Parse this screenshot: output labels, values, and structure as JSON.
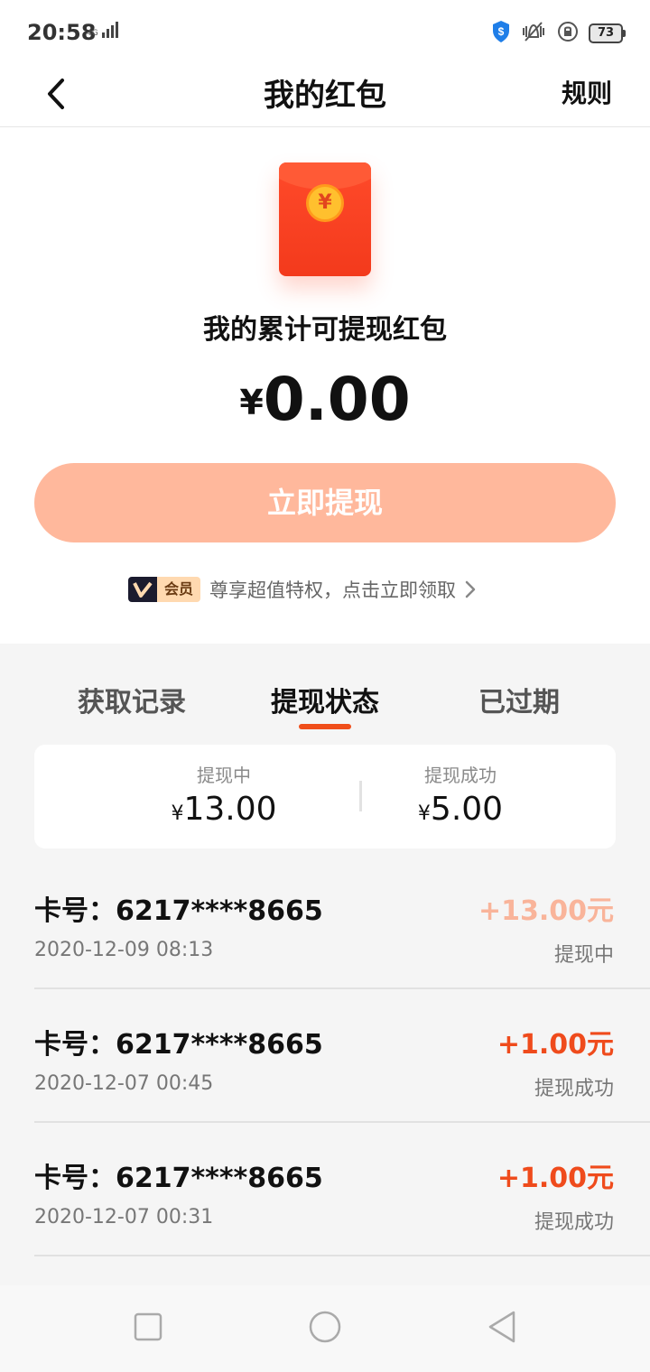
{
  "status_bar": {
    "time": "20:58",
    "network": "4G",
    "battery": "73"
  },
  "nav": {
    "title": "我的红包",
    "rules_label": "规则"
  },
  "summary_top": {
    "label": "我的累计可提现红包",
    "currency": "¥",
    "amount": "0.00"
  },
  "withdraw_button": {
    "label": "立即提现"
  },
  "vip": {
    "badge": "会员",
    "description": "尊享超值特权，点击立即领取"
  },
  "tabs": [
    {
      "label": "获取记录",
      "active": false
    },
    {
      "label": "提现状态",
      "active": true
    },
    {
      "label": "已过期",
      "active": false
    }
  ],
  "stats": {
    "pending": {
      "label": "提现中",
      "currency": "¥",
      "amount": "13.00"
    },
    "success": {
      "label": "提现成功",
      "currency": "¥",
      "amount": "5.00"
    }
  },
  "records": [
    {
      "card": "卡号：6217****8665",
      "date": "2020-12-09 08:13",
      "amount": "+13.00元",
      "status": "提现中",
      "amount_color": "#f9b49a"
    },
    {
      "card": "卡号：6217****8665",
      "date": "2020-12-07 00:45",
      "amount": "+1.00元",
      "status": "提现成功",
      "amount_color": "#ef4b1c"
    },
    {
      "card": "卡号：6217****8665",
      "date": "2020-12-07 00:31",
      "amount": "+1.00元",
      "status": "提现成功",
      "amount_color": "#ef4b1c"
    }
  ],
  "colors": {
    "accent": "#f04e1a",
    "button_bg": "#ffb89c",
    "section_bg": "#f5f5f5"
  },
  "icons": {
    "back": "chevron-left-icon",
    "vip_arrow": "chevron-right-icon",
    "nav_recent": "square-icon",
    "nav_home": "circle-icon",
    "nav_back": "triangle-left-icon"
  }
}
